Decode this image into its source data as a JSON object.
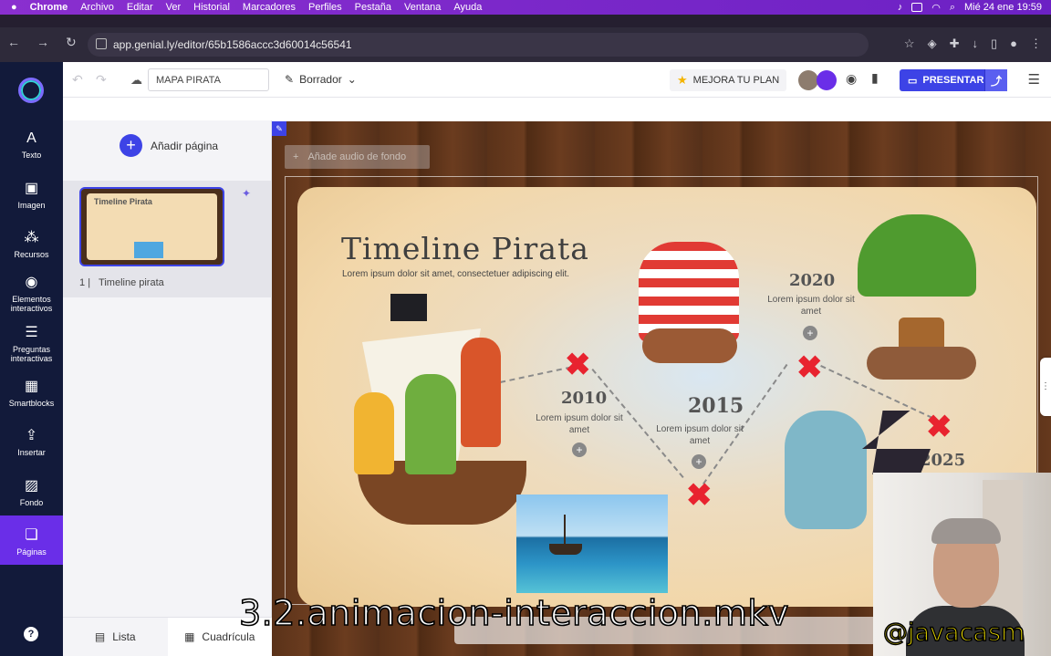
{
  "menubar": {
    "app": "Chrome",
    "menus": [
      "Archivo",
      "Editar",
      "Ver",
      "Historial",
      "Marcadores",
      "Perfiles",
      "Pestaña",
      "Ventana",
      "Ayuda"
    ],
    "clock": "Mié 24 ene  19:59"
  },
  "browser": {
    "url": "app.genial.ly/editor/65b1586accc3d60014c56541"
  },
  "toolbar": {
    "title_value": "MAPA PIRATA",
    "draft_label": "Borrador",
    "upgrade_label": "MEJORA TU PLAN",
    "present_label": "PRESENTAR"
  },
  "rail": {
    "items": [
      {
        "label": "Texto",
        "icon": "text-icon"
      },
      {
        "label": "Imagen",
        "icon": "image-icon"
      },
      {
        "label": "Recursos",
        "icon": "resources-icon"
      },
      {
        "label": "Elementos interactivos",
        "icon": "interactive-icon"
      },
      {
        "label": "Preguntas interactivas",
        "icon": "questions-icon"
      },
      {
        "label": "Smartblocks",
        "icon": "smartblocks-icon"
      },
      {
        "label": "Insertar",
        "icon": "insert-icon"
      },
      {
        "label": "Fondo",
        "icon": "background-icon"
      },
      {
        "label": "Páginas",
        "icon": "pages-icon"
      }
    ],
    "help": "?"
  },
  "pages_panel": {
    "add_page": "Añadir página",
    "page_number": "1",
    "page_name": "Timeline pirata",
    "thumb_title": "Timeline Pirata",
    "view_list": "Lista",
    "view_grid": "Cuadrícula"
  },
  "canvas": {
    "audio_label": "Añade audio de fondo",
    "title": "Timeline Pirata",
    "subtitle": "Lorem ipsum dolor sit amet, consectetuer adipiscing elit.",
    "milestones": [
      {
        "year": "2010",
        "text": "Lorem ipsum dolor sit amet"
      },
      {
        "year": "2015",
        "text": "Lorem ipsum dolor sit amet"
      },
      {
        "year": "2020",
        "text": "Lorem ipsum dolor sit amet"
      },
      {
        "year": "2025",
        "text": ""
      }
    ]
  },
  "overlay": {
    "subtitle_text": "3.2.animacion-interaccion.mkv",
    "watermark": "@javacasm"
  },
  "colors": {
    "accent": "#3d43e6",
    "rail": "#121a3a",
    "active_rail": "#6a2ee8",
    "menubar": "#7a27c9"
  }
}
